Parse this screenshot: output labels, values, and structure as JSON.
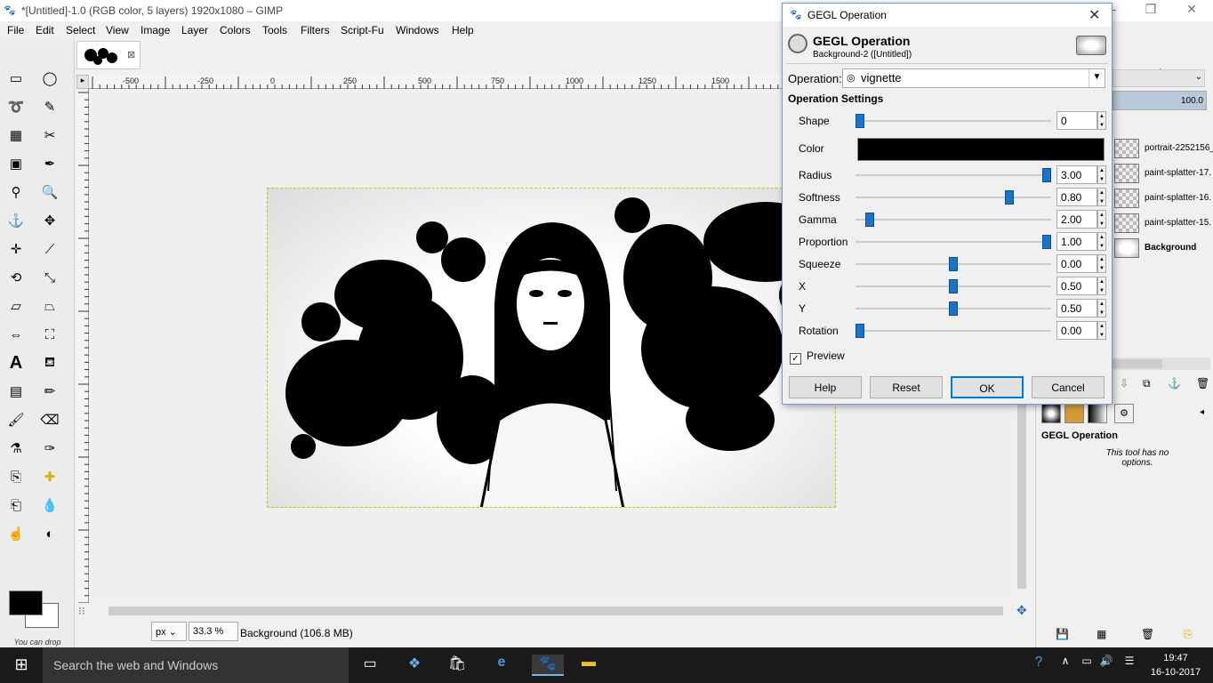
{
  "window": {
    "title": "*[Untitled]-1.0 (RGB color, 5 layers) 1920x1080 – GIMP",
    "min": "—",
    "max": "❐",
    "close": "✕"
  },
  "menu": [
    "File",
    "Edit",
    "Select",
    "View",
    "Image",
    "Layer",
    "Colors",
    "Tools",
    "Filters",
    "Script-Fu",
    "Windows",
    "Help"
  ],
  "ruler": {
    "h_ticks": [
      "-500",
      "-250",
      "0",
      "250",
      "500",
      "750",
      "1000",
      "1250",
      "1500"
    ]
  },
  "toolbox": {
    "drop_note": "You can drop dockable dialogs"
  },
  "status": {
    "unit": "px",
    "zoom": "33.3 %",
    "layer_info": "Background (106.8 MB)"
  },
  "layers": {
    "opacity": "100.0",
    "items": [
      {
        "name": "portrait-2252156_"
      },
      {
        "name": "paint-splatter-17."
      },
      {
        "name": "paint-splatter-16."
      },
      {
        "name": "paint-splatter-15."
      },
      {
        "name": "Background"
      }
    ]
  },
  "tool_options": {
    "title": "GEGL Operation",
    "note": "This tool has no options."
  },
  "dialog": {
    "title": "GEGL Operation",
    "header_name": "GEGL Operation",
    "header_sub": "Background-2 ([Untitled])",
    "operation_label": "Operation:",
    "operation_value": "vignette",
    "settings_title": "Operation Settings",
    "params": [
      {
        "label": "Shape",
        "value": "0",
        "fraction": 0.0
      },
      {
        "label": "Color",
        "value": "#000000"
      },
      {
        "label": "Radius",
        "value": "3.00",
        "fraction": 1.0
      },
      {
        "label": "Softness",
        "value": "0.80",
        "fraction": 0.8
      },
      {
        "label": "Gamma",
        "value": "2.00",
        "fraction": 0.05
      },
      {
        "label": "Proportion",
        "value": "1.00",
        "fraction": 1.0
      },
      {
        "label": "Squeeze",
        "value": "0.00",
        "fraction": 0.5
      },
      {
        "label": "X",
        "value": "0.50",
        "fraction": 0.5
      },
      {
        "label": "Y",
        "value": "0.50",
        "fraction": 0.5
      },
      {
        "label": "Rotation",
        "value": "0.00",
        "fraction": 0.0
      }
    ],
    "preview_label": "Preview",
    "preview_checked": true,
    "buttons": {
      "help": "Help",
      "reset": "Reset",
      "ok": "OK",
      "cancel": "Cancel"
    }
  },
  "taskbar": {
    "search_placeholder": "Search the web and Windows",
    "time": "19:47",
    "date": "16-10-2017"
  }
}
